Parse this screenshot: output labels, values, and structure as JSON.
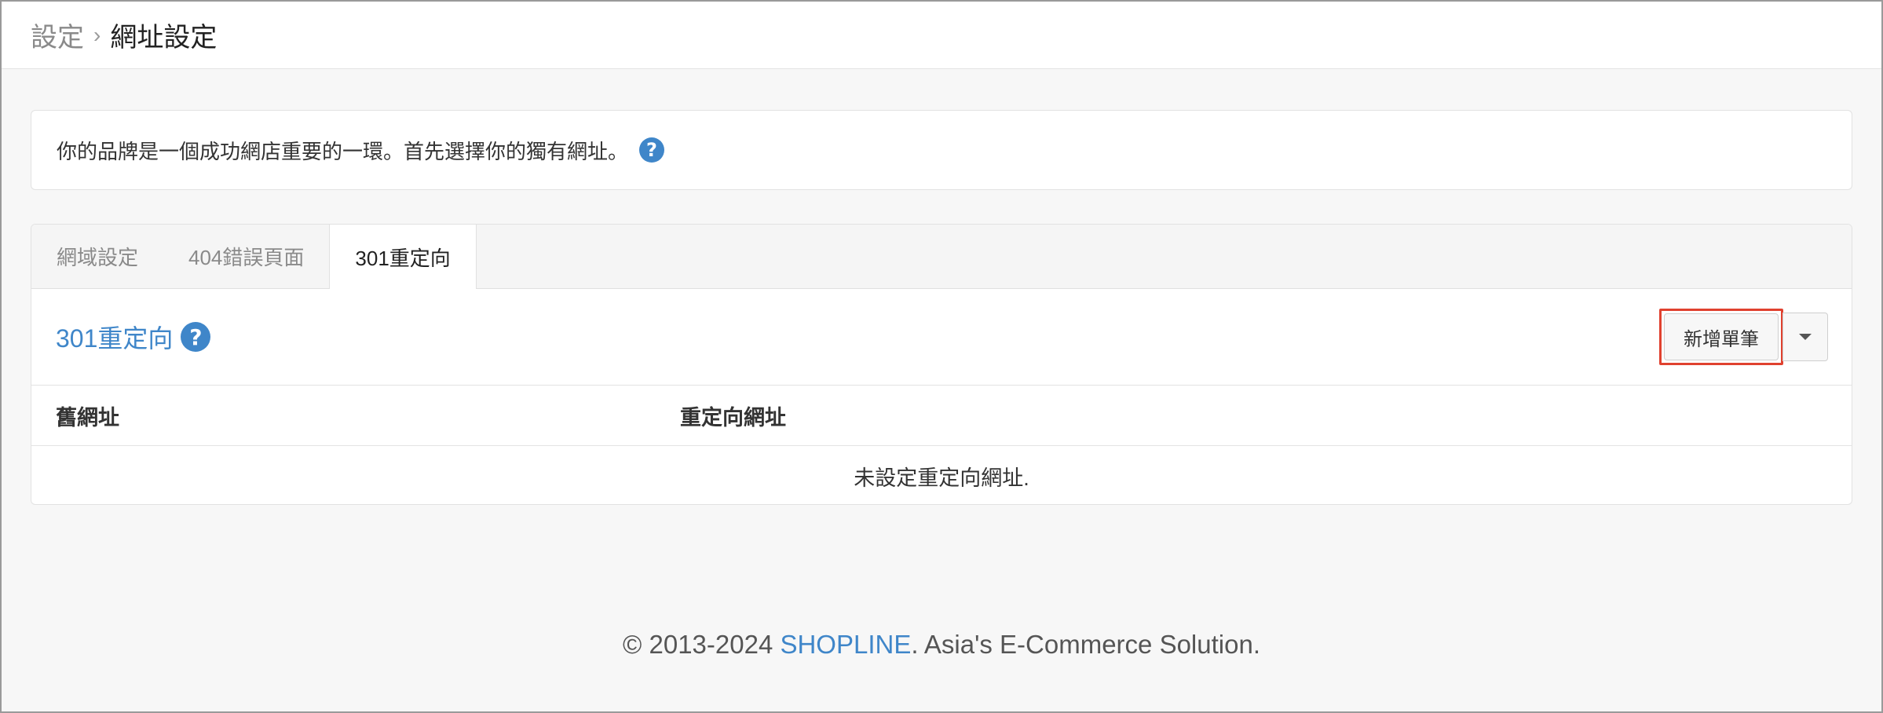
{
  "breadcrumb": {
    "parent": "設定",
    "separator": "›",
    "current": "網址設定"
  },
  "notice": {
    "text": "你的品牌是一個成功網店重要的一環。首先選擇你的獨有網址。",
    "help_icon": "?"
  },
  "tabs": [
    {
      "label": "網域設定",
      "active": false
    },
    {
      "label": "404錯誤頁面",
      "active": false
    },
    {
      "label": "301重定向",
      "active": true
    }
  ],
  "section": {
    "title": "301重定向",
    "help_icon": "?"
  },
  "toolbar": {
    "add_label": "新增單筆"
  },
  "table": {
    "headers": [
      "舊網址",
      "重定向網址"
    ],
    "empty_message": "未設定重定向網址."
  },
  "footer": {
    "prefix": "© 2013-2024 ",
    "brand": "SHOPLINE",
    "suffix": ". Asia's E-Commerce Solution."
  },
  "colors": {
    "accent": "#3f86c9",
    "highlight": "#e0412f"
  }
}
